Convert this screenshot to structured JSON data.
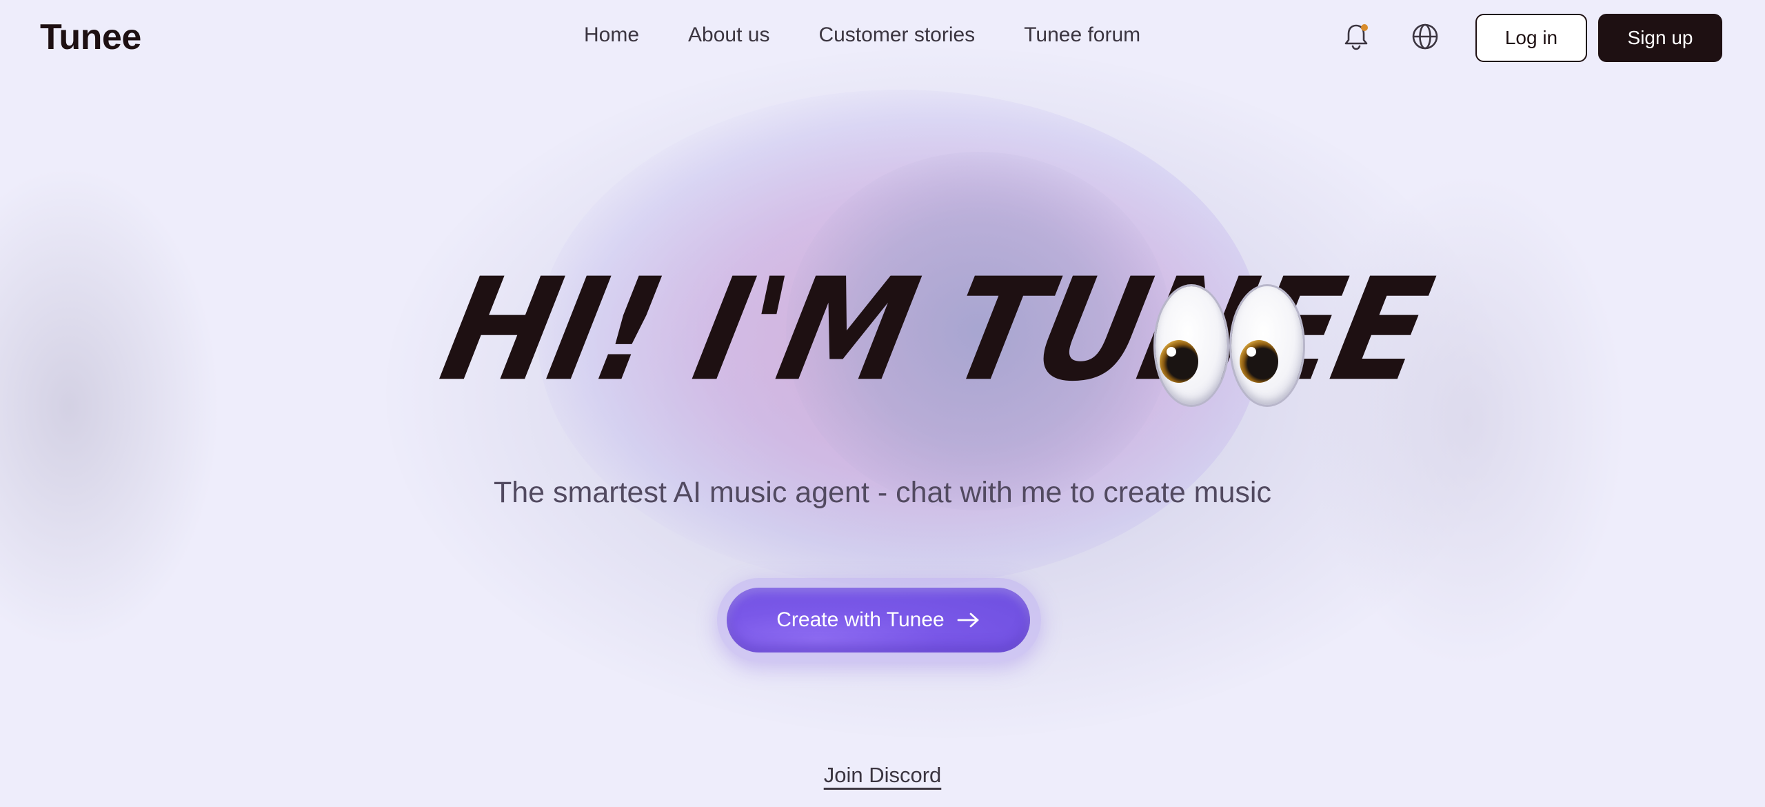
{
  "brand": {
    "logo": "Tunee"
  },
  "nav": {
    "items": [
      {
        "label": "Home"
      },
      {
        "label": "About us"
      },
      {
        "label": "Customer stories"
      },
      {
        "label": "Tunee forum"
      }
    ]
  },
  "header_icons": {
    "notifications": "bell-icon",
    "language": "globe-icon",
    "notification_dot_color": "#d98c2b"
  },
  "auth": {
    "login_label": "Log in",
    "signup_label": "Sign up"
  },
  "hero": {
    "title": "HI! I'M TUNEE",
    "title_emoji": "eyes-emoji",
    "tagline": "The smartest AI music agent - chat with me to create music",
    "cta_label": "Create with Tunee",
    "cta_icon": "arrow-right-icon"
  },
  "footer_link": {
    "label": "Join Discord"
  },
  "colors": {
    "text_dark": "#1e1012",
    "accent_purple": "#7a58e8",
    "background": "#eeedfb"
  }
}
